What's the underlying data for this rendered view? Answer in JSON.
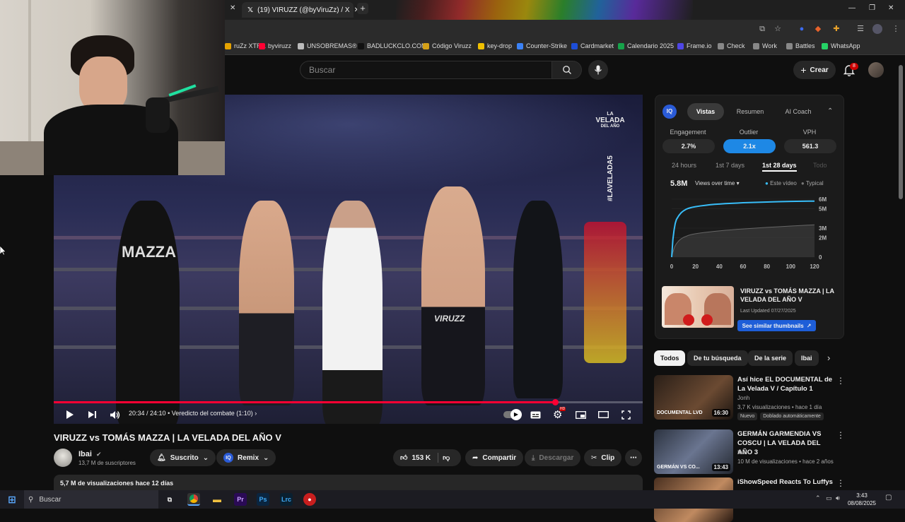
{
  "browser": {
    "tabs": [
      {
        "label": "(19) VIRUZZ (@byViruZz) / X",
        "active": true
      }
    ],
    "bookmarks": [
      {
        "label": "ruZz XTRA",
        "color": "#e6a300"
      },
      {
        "label": "byviruzz",
        "color": "#ff0033"
      },
      {
        "label": "UNSOBREMAS®",
        "color": "#bbbbbb"
      },
      {
        "label": "BADLUCKCLO.COM",
        "color": "#111111"
      },
      {
        "label": "Código Viruzz",
        "color": "#d4a017"
      },
      {
        "label": "key-drop",
        "color": "#f0c000"
      },
      {
        "label": "Counter-Strike",
        "color": "#3b82f6"
      },
      {
        "label": "Cardmarket",
        "color": "#1d4ed8"
      },
      {
        "label": "Calendario 2025",
        "color": "#16a34a"
      },
      {
        "label": "Frame.io",
        "color": "#4f46e5"
      },
      {
        "label": "Check",
        "color": "#888888"
      },
      {
        "label": "Work",
        "color": "#888888"
      },
      {
        "label": "Battles",
        "color": "#888888"
      },
      {
        "label": "WhatsApp",
        "color": "#25d366"
      }
    ]
  },
  "header": {
    "search_placeholder": "Buscar",
    "create_label": "Crear",
    "notifications_count": "8"
  },
  "player": {
    "time": "20:34 / 24:10",
    "chapter": "• Veredicto del combate (1:10)",
    "progress_fraction": 0.851,
    "brand_top": "LA",
    "brand_main": "VELADA",
    "brand_bottom": "DEL AÑO",
    "hashtag": "#LAVELADA5",
    "trunks_text": "VIRUZZ",
    "shirt_text": "MAZZA"
  },
  "video": {
    "title": "VIRUZZ vs TOMÁS MAZZA | LA VELADA DEL AÑO V",
    "channel": "Ibai",
    "subscribers": "13,7 M de suscriptores",
    "subscribed_label": "Suscrito",
    "remix_label": "Remix",
    "likes": "153 K",
    "share_label": "Compartir",
    "download_label": "Descargar",
    "clip_label": "Clip",
    "views_line": "5,7 M de visualizaciones  hace 12 días"
  },
  "extension": {
    "logo": "IQ",
    "tabs": [
      "Vistas",
      "Resumen",
      "AI Coach"
    ],
    "selected_tab": 0,
    "metrics": [
      {
        "label": "Engagement",
        "value": "2.7%"
      },
      {
        "label": "Outlier",
        "value": "2.1x"
      },
      {
        "label": "VPH",
        "value": "561.3"
      }
    ],
    "ranges": [
      "24 hours",
      "1st 7 days",
      "1st 28 days",
      "Todo"
    ],
    "selected_range": 2,
    "views_total": "5.8M",
    "views_mode": "Views over time",
    "legend": [
      "Este vídeo",
      "Typical"
    ],
    "similar_title": "VIRUZZ vs TOMÁS MAZZA | LA VELADA DEL AÑO V",
    "last_updated": "Last Updated 07/27/2025",
    "similar_button": "See similar thumbnails"
  },
  "chart_data": {
    "type": "area",
    "x": [
      0,
      1,
      2,
      3,
      4,
      6,
      8,
      10,
      12,
      14,
      16,
      18,
      20,
      24,
      28,
      32,
      36,
      40,
      45,
      50,
      55,
      60,
      70,
      80,
      90,
      100,
      110,
      120
    ],
    "series": [
      {
        "name": "Este vídeo",
        "values": [
          0,
          1.8,
          2.8,
          3.5,
          3.9,
          4.3,
          4.6,
          4.8,
          4.95,
          5.05,
          5.12,
          5.18,
          5.22,
          5.3,
          5.36,
          5.42,
          5.47,
          5.5,
          5.54,
          5.57,
          5.6,
          5.63,
          5.67,
          5.71,
          5.74,
          5.77,
          5.79,
          5.8
        ]
      },
      {
        "name": "Typical",
        "values": [
          0,
          0.5,
          0.9,
          1.2,
          1.4,
          1.7,
          1.9,
          2.05,
          2.15,
          2.25,
          2.32,
          2.38,
          2.42,
          2.5,
          2.56,
          2.62,
          2.67,
          2.72,
          2.78,
          2.83,
          2.88,
          2.92,
          3.0,
          3.08,
          3.15,
          3.22,
          3.28,
          3.35
        ]
      }
    ],
    "xticks": [
      "0",
      "20",
      "40",
      "60",
      "80",
      "100",
      "120"
    ],
    "yticks": [
      "0",
      "2M",
      "3M",
      "5M",
      "6M"
    ],
    "ytick_values": [
      0,
      2,
      3,
      5,
      6
    ],
    "xlim": [
      0,
      120
    ],
    "ylim": [
      0,
      6
    ]
  },
  "chips": [
    "Todos",
    "De tu búsqueda",
    "De la serie",
    "Ibai"
  ],
  "recommendations": [
    {
      "title": "Así hice EL DOCUMENTAL de La Velada V / Capítulo 1",
      "channel": "Jonh",
      "meta": "3,7 K visualizaciones • hace 1 día",
      "tags": [
        "Nuevo",
        "Doblado automáticamente"
      ],
      "duration": "16:30",
      "overlay": "DOCUMENTAL LVD"
    },
    {
      "title": "GERMÁN GARMENDIA VS COSCU | LA VELADA DEL AÑO 3",
      "channel": "Ibai",
      "meta": "10 M de visualizaciones • hace 2 años",
      "tags": [],
      "duration": "13:43",
      "overlay": "GERMÁN VS CO..."
    },
    {
      "title": "iShowSpeed Reacts To Luffys",
      "channel": "",
      "meta": "",
      "tags": [],
      "duration": "",
      "overlay": ""
    }
  ],
  "taskbar": {
    "search_label": "Buscar",
    "time": "3:43",
    "date": "08/08/2025"
  }
}
